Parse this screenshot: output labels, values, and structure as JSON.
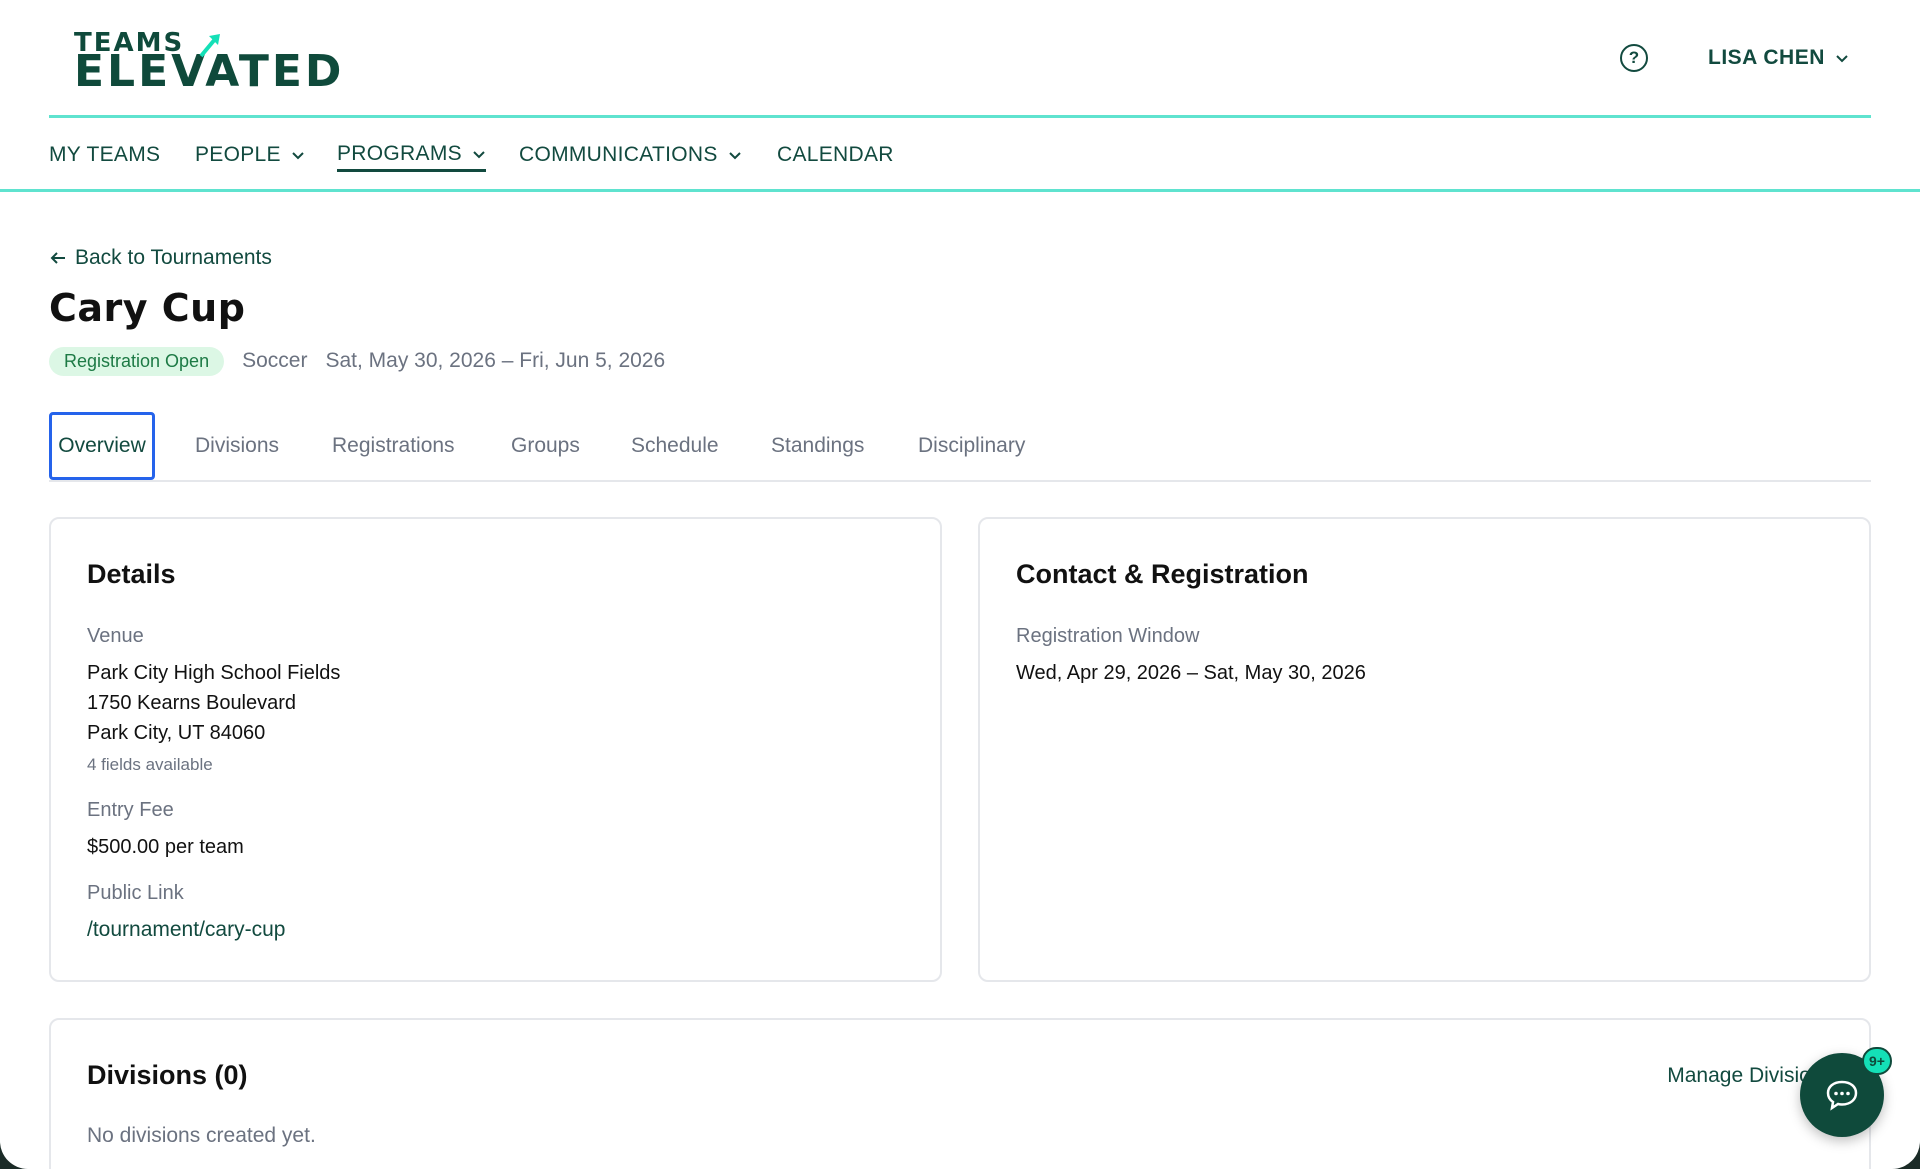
{
  "brand": {
    "logo_top": "TEAMS",
    "logo_main": "ELEVATED",
    "accent": "#5fe3cf",
    "primary": "#124a3f"
  },
  "header": {
    "help_icon": "question-circle-icon",
    "user_name": "LISA CHEN"
  },
  "nav": {
    "items": [
      {
        "label": "MY TEAMS"
      },
      {
        "label": "PEOPLE"
      },
      {
        "label": "PROGRAMS"
      },
      {
        "label": "COMMUNICATIONS"
      },
      {
        "label": "CALENDAR"
      }
    ],
    "active": "PROGRAMS"
  },
  "page": {
    "back_label": "Back to Tournaments",
    "title": "Cary Cup",
    "status": "Registration Open",
    "sport": "Soccer",
    "dates": "Sat, May 30, 2026 – Fri, Jun 5, 2026"
  },
  "tabs": [
    {
      "label": "Overview"
    },
    {
      "label": "Divisions"
    },
    {
      "label": "Registrations"
    },
    {
      "label": "Groups"
    },
    {
      "label": "Schedule"
    },
    {
      "label": "Standings"
    },
    {
      "label": "Disciplinary"
    }
  ],
  "details": {
    "title": "Details",
    "venue_label": "Venue",
    "venue_line1": "Park City High School Fields",
    "venue_line2": "1750 Kearns Boulevard",
    "venue_line3": "Park City, UT 84060",
    "fields_available": "4 fields available",
    "fee_label": "Entry Fee",
    "fee_value": "$500.00 per team",
    "link_label": "Public Link",
    "link_value": "/tournament/cary-cup"
  },
  "contact": {
    "title": "Contact & Registration",
    "window_label": "Registration Window",
    "window_value": "Wed, Apr 29, 2026 – Sat, May 30, 2026"
  },
  "divisions": {
    "title": "Divisions (0)",
    "manage_label": "Manage Divisions",
    "empty_text": "No divisions created yet."
  },
  "chat": {
    "badge": "9+"
  }
}
